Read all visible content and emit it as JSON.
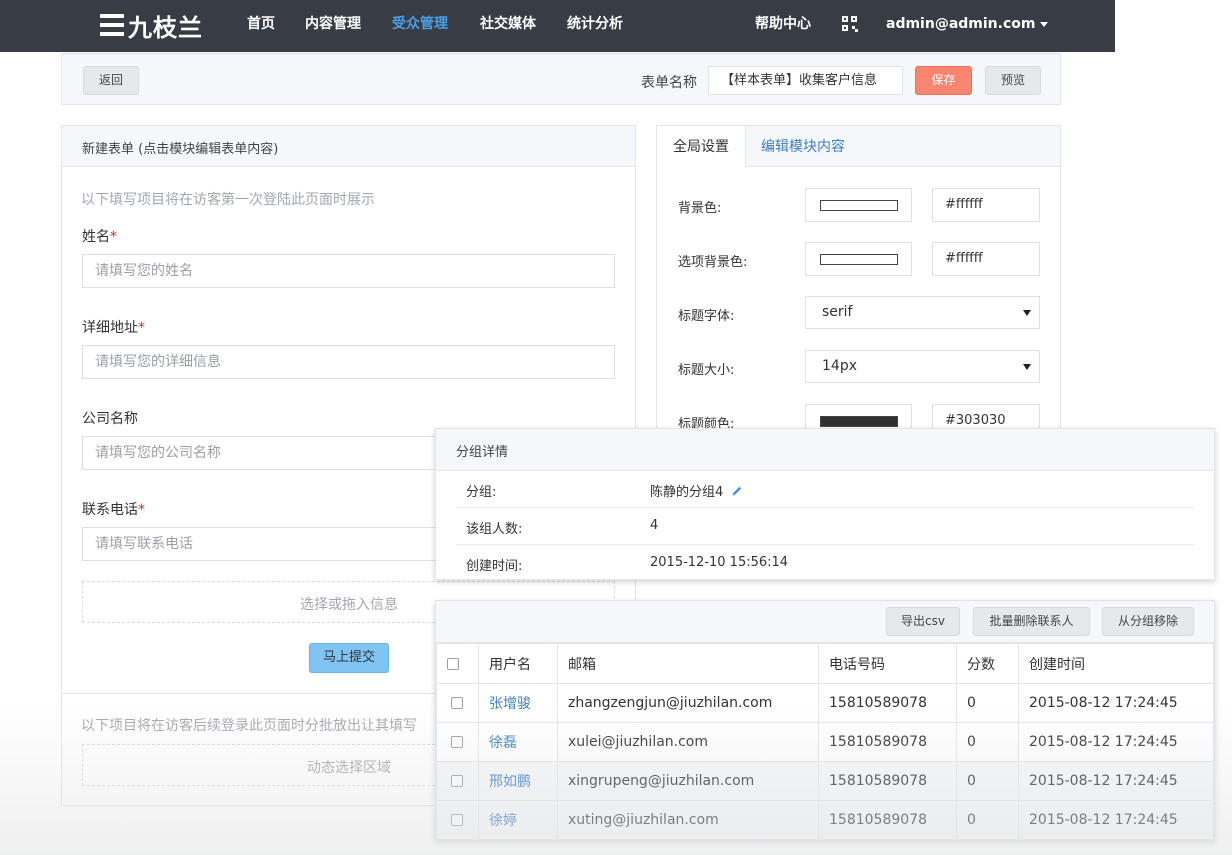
{
  "nav": {
    "logo_text": "九枝兰",
    "items": [
      {
        "label": "首页"
      },
      {
        "label": "内容管理"
      },
      {
        "label": "受众管理"
      },
      {
        "label": "社交媒体"
      },
      {
        "label": "统计分析"
      }
    ],
    "help": "帮助中心",
    "user": "admin@admin.com"
  },
  "toolbar": {
    "back": "返回",
    "form_name_label": "表单名称",
    "form_name_value": "【样本表单】收集客户信息",
    "save": "保存",
    "preview": "预览"
  },
  "form_panel": {
    "title": "新建表单 (点击模块编辑表单内容)",
    "intro": "以下填写项目将在访客第一次登陆此页面时展示",
    "fields": [
      {
        "label": "姓名",
        "required": "*",
        "placeholder": "请填写您的姓名"
      },
      {
        "label": "详细地址",
        "required": "*",
        "placeholder": "请填写您的详细信息"
      },
      {
        "label": "公司名称",
        "required": "",
        "placeholder": "请填写您的公司名称"
      },
      {
        "label": "联系电话",
        "required": "*",
        "placeholder": "请填写联系电话"
      }
    ],
    "drop_zone": "选择或拖入信息",
    "submit": "马上提交",
    "later_note": "以下项目将在访客后续登录此页面时分批放出让其填写",
    "dynamic_zone": "动态选择区域"
  },
  "settings_panel": {
    "tabs": [
      {
        "label": "全局设置"
      },
      {
        "label": "编辑模块内容"
      }
    ],
    "rows": [
      {
        "label": "背景色:",
        "value": "#ffffff"
      },
      {
        "label": "选项背景色:",
        "value": "#ffffff"
      },
      {
        "label": "标题字体:",
        "value": "serif"
      },
      {
        "label": "标题大小:",
        "value": "14px"
      },
      {
        "label": "标题颜色:",
        "value": "#303030"
      }
    ]
  },
  "group_panel": {
    "title": "分组详情",
    "rows": [
      {
        "key": "分组:",
        "value": "陈静的分组4"
      },
      {
        "key": "该组人数:",
        "value": "4"
      },
      {
        "key": "创建时间:",
        "value": "2015-12-10 15:56:14"
      }
    ]
  },
  "users_panel": {
    "actions": {
      "export": "导出csv",
      "batch_delete": "批量删除联系人",
      "remove": "从分组移除"
    },
    "columns": [
      "用户名",
      "邮箱",
      "电话号码",
      "分数",
      "创建时间"
    ],
    "rows": [
      {
        "name": "张增骏",
        "email": "zhangzengjun@jiuzhilan.com",
        "phone": "15810589078",
        "score": "0",
        "created": "2015-08-12 17:24:45"
      },
      {
        "name": "徐磊",
        "email": "xulei@jiuzhilan.com",
        "phone": "15810589078",
        "score": "0",
        "created": "2015-08-12 17:24:45"
      },
      {
        "name": "邢如鹏",
        "email": "xingrupeng@jiuzhilan.com",
        "phone": "15810589078",
        "score": "0",
        "created": "2015-08-12 17:24:45"
      },
      {
        "name": "徐婷",
        "email": "xuting@jiuzhilan.com",
        "phone": "15810589078",
        "score": "0",
        "created": "2015-08-12 17:24:45"
      }
    ]
  },
  "colors": {
    "nav_bg": "#383d45",
    "nav_active": "#4a9fe8",
    "save_btn": "#f88570",
    "submit_btn": "#7fc4f2",
    "link": "#3e7fc0",
    "required": "#c9302c",
    "swatch_dark": "#303030"
  }
}
